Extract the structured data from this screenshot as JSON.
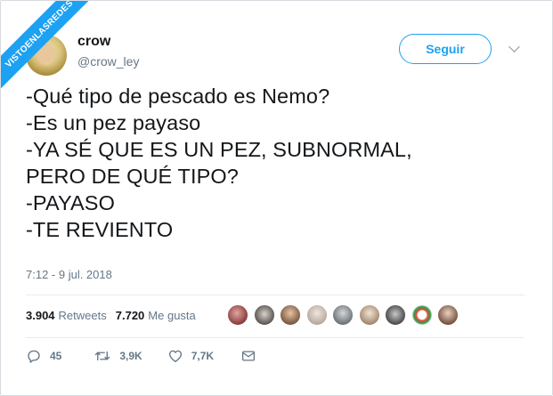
{
  "watermark": "VISTOENLASREDES",
  "user": {
    "name": "crow",
    "handle": "@crow_ley"
  },
  "follow_button": "Seguir",
  "tweet_lines": [
    "-Qué tipo de pescado es Nemo?",
    "-Es un pez payaso",
    "-YA SÉ QUE ES UN PEZ, SUBNORMAL,",
    "PERO DE QUÉ TIPO?",
    "-PAYASO",
    "-TE REVIENTO"
  ],
  "timestamp": "7:12 - 9 jul. 2018",
  "stats": {
    "retweets_count": "3.904",
    "retweets_label": "Retweets",
    "likes_count": "7.720",
    "likes_label": "Me gusta"
  },
  "actions": {
    "replies": "45",
    "retweets": "3,9K",
    "likes": "7,7K"
  },
  "colors": {
    "accent": "#1da1f2",
    "secondary_text": "#657786",
    "text": "#14171a"
  },
  "icons": [
    "reply-icon",
    "retweet-icon",
    "like-icon",
    "message-icon",
    "chevron-down-icon"
  ]
}
